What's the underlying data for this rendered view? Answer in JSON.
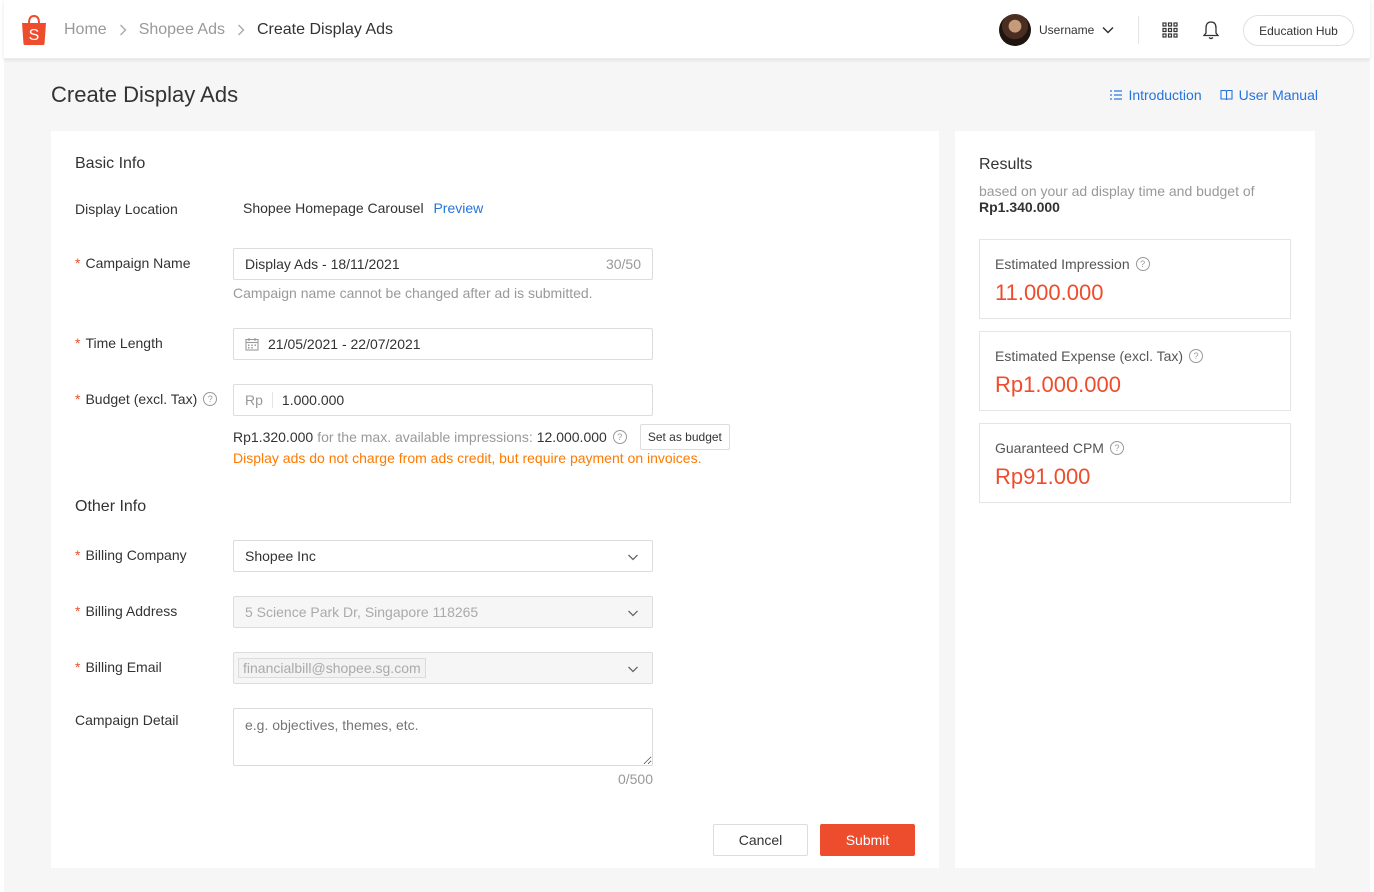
{
  "colors": {
    "brand": "#ee4d2d",
    "link": "#2673dd",
    "warning": "#ff7a00"
  },
  "header": {
    "breadcrumbs": [
      "Home",
      "Shopee Ads",
      "Create Display Ads"
    ],
    "username": "Username",
    "education_hub": "Education Hub",
    "icons": [
      "shopee-logo",
      "chevron-down-icon",
      "apps-grid-icon",
      "bell-icon"
    ]
  },
  "page": {
    "title": "Create Display Ads",
    "links": {
      "introduction": "Introduction",
      "user_manual": "User Manual"
    }
  },
  "form": {
    "basic_info_title": "Basic Info",
    "display_location": {
      "label": "Display Location",
      "value": "Shopee Homepage Carousel",
      "preview": "Preview"
    },
    "campaign_name": {
      "label": "Campaign Name",
      "value": "Display Ads - 18/11/2021",
      "counter": "30/50",
      "hint": "Campaign name cannot be changed after ad is submitted."
    },
    "time_length": {
      "label": "Time Length",
      "value": "21/05/2021 - 22/07/2021"
    },
    "budget": {
      "label": "Budget (excl. Tax)",
      "prefix": "Rp",
      "value": "1.000.000",
      "max_amount": "Rp1.320.000",
      "max_text": "for the max. available impressions:",
      "max_impressions": "12.000.000",
      "set_button": "Set as budget",
      "warning": "Display ads do not charge from ads credit, but require payment on invoices."
    },
    "other_info_title": "Other Info",
    "billing_company": {
      "label": "Billing Company",
      "value": "Shopee Inc"
    },
    "billing_address": {
      "label": "Billing Address",
      "value": "5 Science Park Dr, Singapore 118265"
    },
    "billing_email": {
      "label": "Billing Email",
      "value": "financialbill@shopee.sg.com"
    },
    "campaign_detail": {
      "label": "Campaign Detail",
      "placeholder": "e.g. objectives, themes, etc.",
      "counter": "0/500"
    },
    "cancel": "Cancel",
    "submit": "Submit"
  },
  "results": {
    "title": "Results",
    "subtitle": "based on your ad display time and budget of",
    "budget": "Rp1.340.000",
    "items": [
      {
        "label": "Estimated Impression",
        "value": "11.000.000"
      },
      {
        "label": "Estimated Expense (excl. Tax)",
        "value": "Rp1.000.000"
      },
      {
        "label": "Guaranteed CPM",
        "value": "Rp91.000"
      }
    ]
  }
}
